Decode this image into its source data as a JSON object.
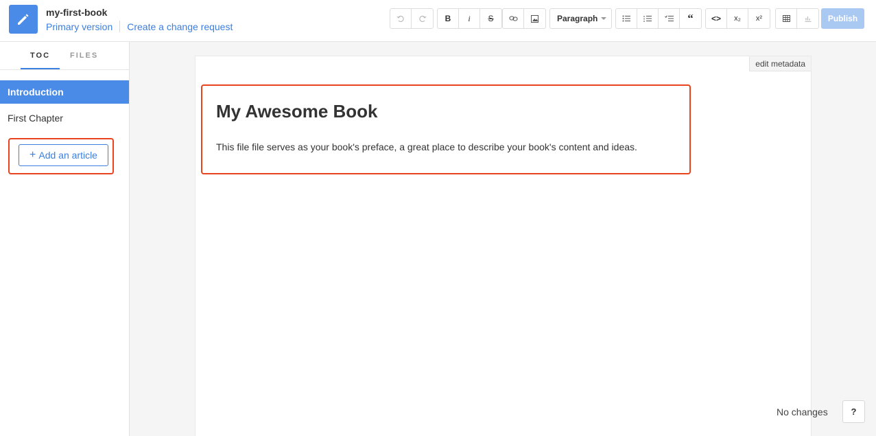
{
  "header": {
    "book_title": "my-first-book",
    "primary_version": "Primary version",
    "change_request": "Create a change request"
  },
  "toolbar": {
    "undo_icon": "undo-icon",
    "redo_icon": "redo-icon",
    "bold": "B",
    "italic": "i",
    "strike": "S",
    "link_icon": "link-icon",
    "image_icon": "image-icon",
    "paragraph": "Paragraph",
    "bullet_list_icon": "bullet-list-icon",
    "numbered_list_icon": "numbered-list-icon",
    "task_list_icon": "task-list-icon",
    "quote": "“",
    "code": "<>",
    "subscript": "x₂",
    "superscript": "x²",
    "table_icon": "table-icon",
    "chart_icon": "chart-icon",
    "publish": "Publish"
  },
  "sidebar": {
    "tabs": [
      {
        "label": "TOC"
      },
      {
        "label": "FILES"
      }
    ],
    "items": [
      {
        "label": "Introduction"
      },
      {
        "label": "First Chapter"
      }
    ],
    "add_article": "Add an article",
    "add_plus": "+"
  },
  "editor": {
    "edit_metadata": "edit metadata",
    "title": "My Awesome Book",
    "body": "This file file serves as your book's preface, a great place to describe your book's content and ideas."
  },
  "footer": {
    "status": "No changes",
    "help": "?"
  },
  "colors": {
    "accent": "#3b7fe0",
    "active_item": "#4a8be8",
    "highlight": "#e8421f",
    "publish_disabled": "#a9c9f3"
  }
}
